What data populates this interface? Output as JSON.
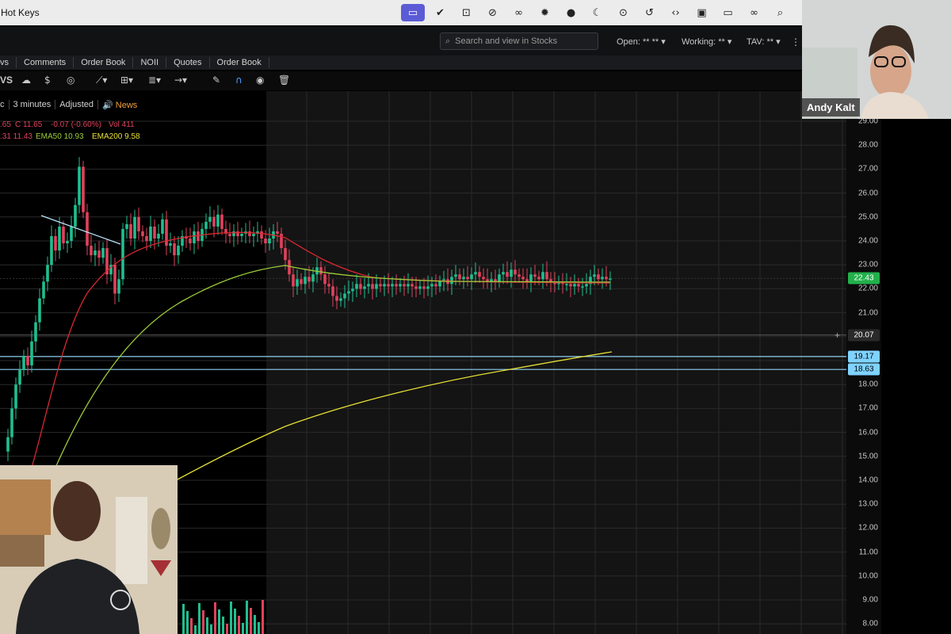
{
  "app": {
    "window_title": "Hot Keys"
  },
  "menubar_icons": [
    "screen-share-icon",
    "check-badge-icon",
    "record-icon",
    "slash-icon",
    "creative-cloud-icon",
    "settings-icon",
    "chat-icon",
    "moon-icon",
    "play-circle-icon",
    "history-icon",
    "code-icon",
    "window-icon",
    "battery-icon",
    "link-icon",
    "search-icon",
    "control-center-icon"
  ],
  "header": {
    "search_placeholder": "Search and view in Stocks",
    "open_label": "Open:",
    "open_value": "** **",
    "working_label": "Working:",
    "working_value": "**",
    "tav_label": "TAV:",
    "tav_value": "**"
  },
  "tabs": [
    "vs",
    "Comments",
    "Order Book",
    "NOII",
    "Quotes",
    "Order Book"
  ],
  "toolbar": {
    "ticker_fragment": "VS"
  },
  "infobar": {
    "interval_fragment": "c",
    "timeframe": "3 minutes",
    "adjustment": "Adjusted",
    "news": "News"
  },
  "studies": {
    "ohlc_fragment": ".65",
    "close_label": "C 11.65",
    "change": "-0.07 (-0.60%)",
    "volume": "Vol 411",
    "ema_fragment": ".31 11.43",
    "ema50": "EMA50 10.93",
    "ema200": "EMA200 9.58"
  },
  "axis_ticks": [
    "29.00",
    "28.00",
    "27.00",
    "26.00",
    "25.00",
    "24.00",
    "23.00",
    "22.00",
    "21.00",
    "20.00",
    "19.00",
    "18.00",
    "17.00",
    "16.00",
    "15.00",
    "14.00",
    "13.00",
    "12.00",
    "11.00",
    "10.00",
    "9.00",
    "8.00"
  ],
  "price_tags": [
    {
      "value": "22.43",
      "bg": "#22b04b",
      "fg": "#ffffff",
      "price": 22.43
    },
    {
      "value": "20.07",
      "bg": "#2a2a2a",
      "fg": "#ffffff",
      "price": 20.07
    },
    {
      "value": "19.17",
      "bg": "#7fd3ff",
      "fg": "#000000",
      "price": 19.17
    },
    {
      "value": "18.63",
      "bg": "#7fd3ff",
      "fg": "#000000",
      "price": 18.63
    }
  ],
  "colors": {
    "up": "#1fbf8f",
    "down": "#e0425c",
    "ema_red": "#d8282f",
    "ema_green": "#9ccc3a",
    "ema_yellow": "#e6e035",
    "hline": "#8fd0f0"
  },
  "participants": {
    "remote_name": "Andy Kalt"
  },
  "chart_data": {
    "type": "candlestick",
    "y_axis_range": [
      8,
      29.3
    ],
    "horizontal_lines": [
      20.07,
      19.17,
      18.63
    ],
    "last_price": 22.43
  }
}
